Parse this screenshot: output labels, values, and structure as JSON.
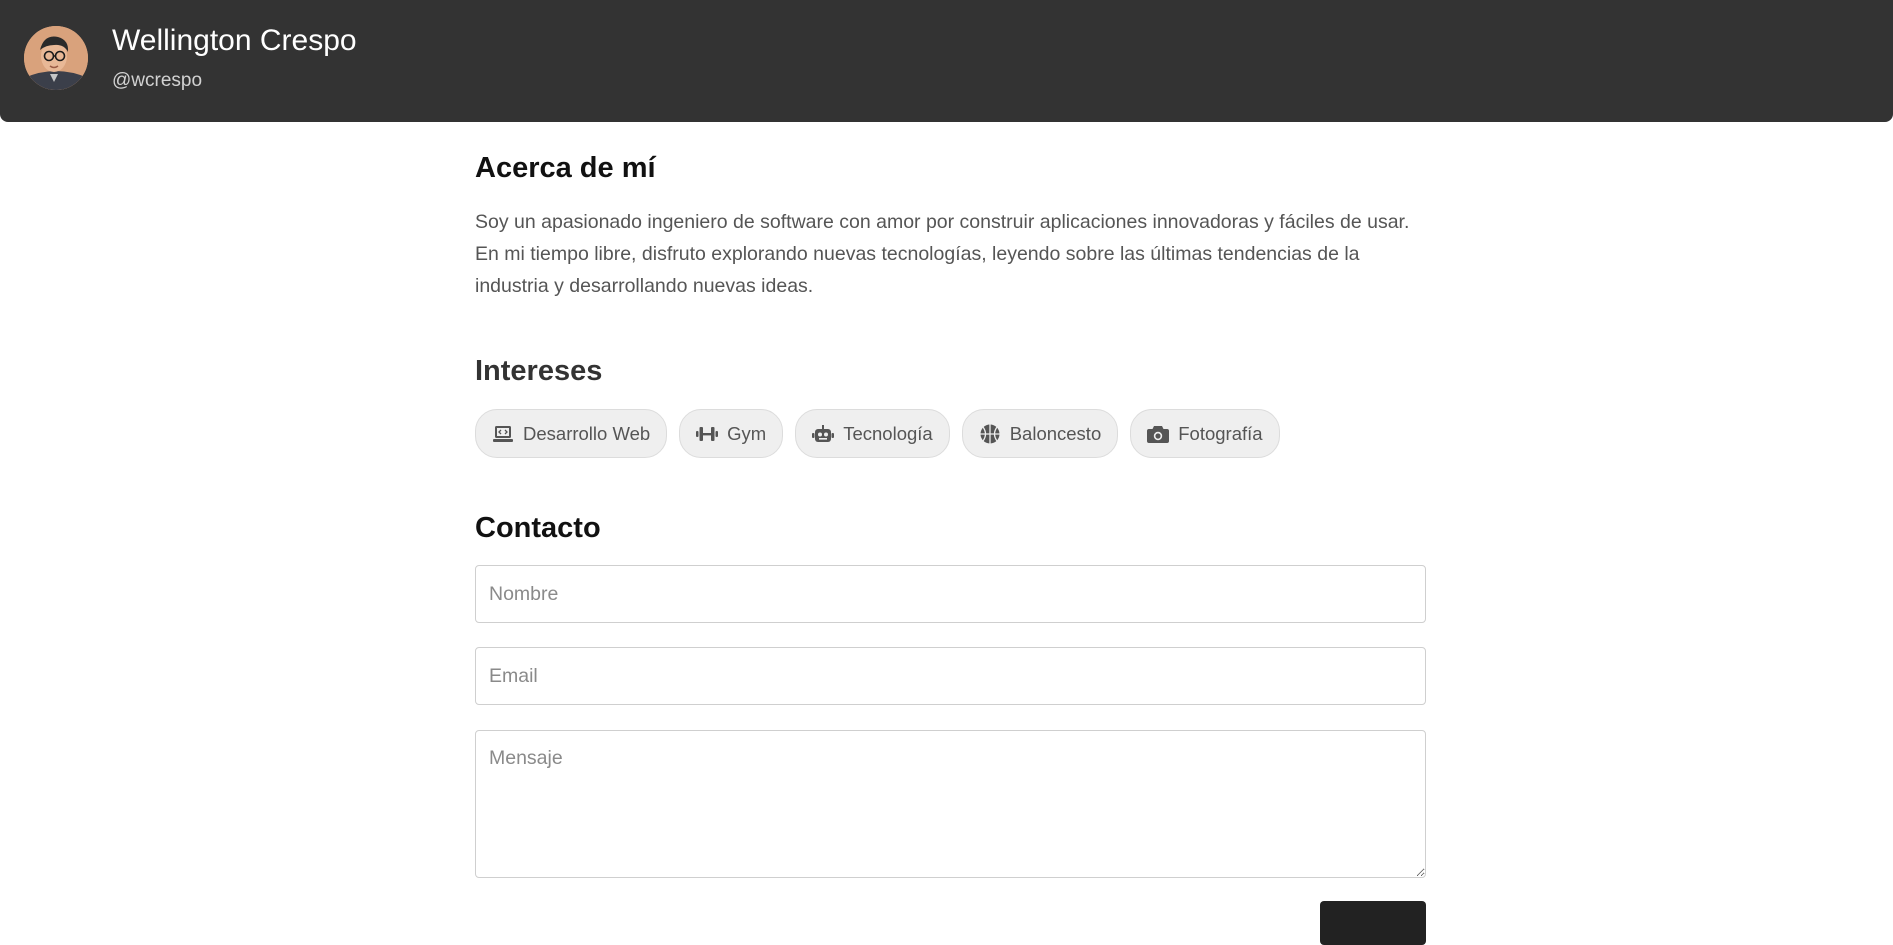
{
  "profile": {
    "name": "Wellington Crespo",
    "handle": "@wcrespo",
    "avatar_icon": "avatar-photo"
  },
  "about": {
    "title": "Acerca de mí",
    "text": "Soy un apasionado ingeniero de software con amor por construir aplicaciones innovadoras y fáciles de usar. En mi tiempo libre, disfruto explorando nuevas tecnologías, leyendo sobre las últimas tendencias de la industria y desarrollando nuevas ideas."
  },
  "interests": {
    "title": "Intereses",
    "items": [
      {
        "label": "Desarrollo Web",
        "icon": "laptop-code-icon"
      },
      {
        "label": "Gym",
        "icon": "dumbbell-icon"
      },
      {
        "label": "Tecnología",
        "icon": "robot-icon"
      },
      {
        "label": "Baloncesto",
        "icon": "basketball-icon"
      },
      {
        "label": "Fotografía",
        "icon": "camera-icon"
      }
    ]
  },
  "contact": {
    "title": "Contacto",
    "name_placeholder": "Nombre",
    "email_placeholder": "Email",
    "message_placeholder": "Mensaje",
    "name_value": "",
    "email_value": "",
    "message_value": ""
  },
  "colors": {
    "header_bg": "#333333",
    "chip_bg": "#efefef",
    "text_muted": "#555555"
  }
}
